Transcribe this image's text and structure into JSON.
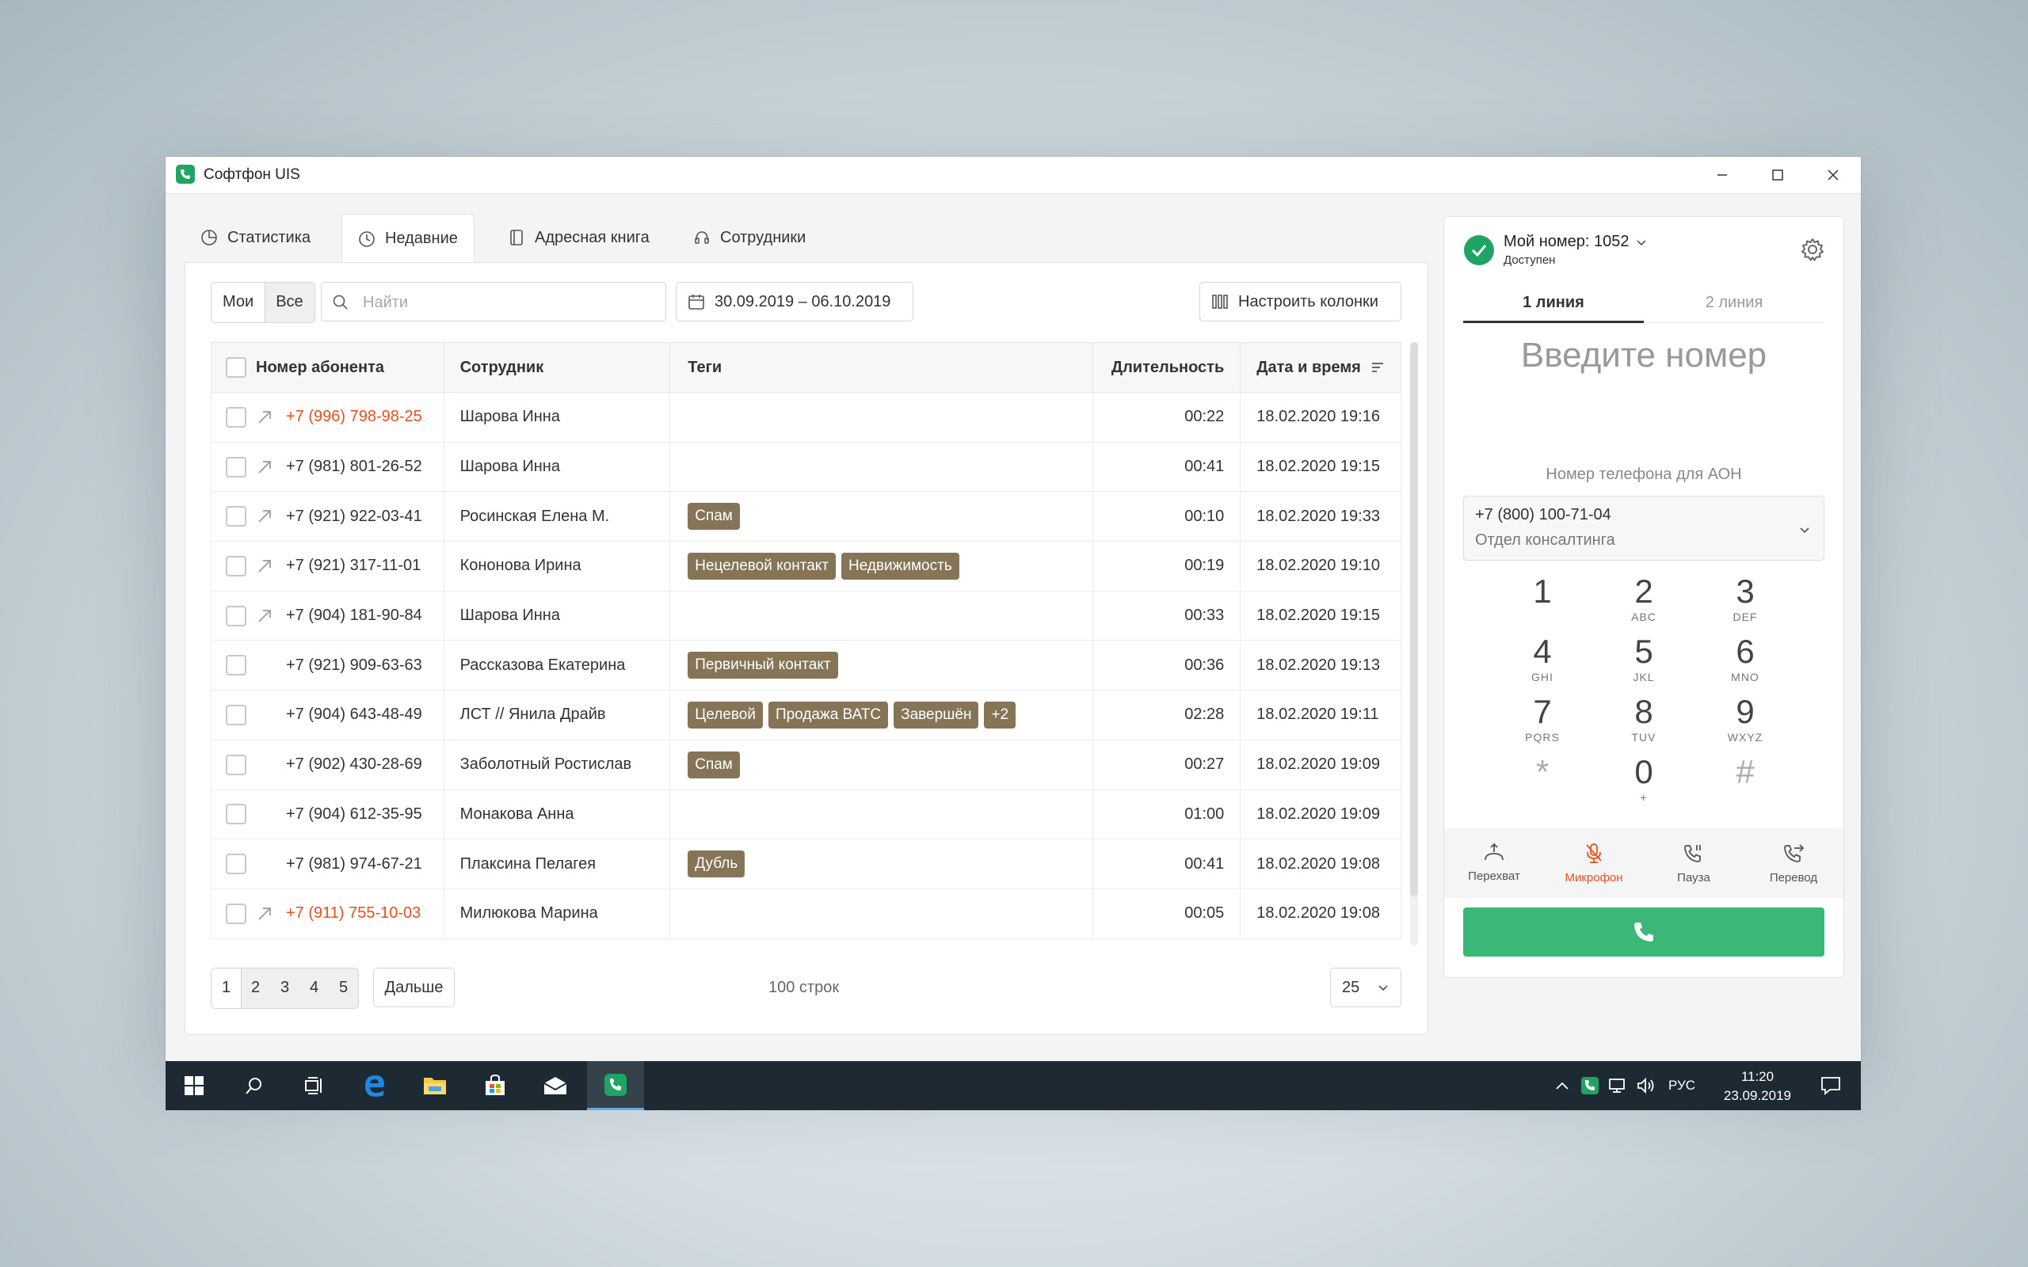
{
  "window": {
    "title": "Софтфон UIS"
  },
  "tabs": [
    {
      "label": "Статистика",
      "icon": "chart-icon"
    },
    {
      "label": "Недавние",
      "icon": "clock-icon"
    },
    {
      "label": "Адресная книга",
      "icon": "address-book-icon"
    },
    {
      "label": "Сотрудники",
      "icon": "employees-icon"
    }
  ],
  "filters": {
    "mine_label": "Мои",
    "all_label": "Все",
    "search_placeholder": "Найти",
    "search_value": "",
    "date_range": "30.09.2019 – 06.10.2019",
    "columns_button": "Настроить колонки"
  },
  "table": {
    "headers": [
      "Номер абонента",
      "Сотрудник",
      "Теги",
      "Длительность",
      "Дата и время"
    ],
    "rows": [
      {
        "number": "+7 (996) 798-98-25",
        "missed": true,
        "outgoing": true,
        "employee": "Шарова Инна",
        "tags": [],
        "duration": "00:22",
        "datetime": "18.02.2020 19:16"
      },
      {
        "number": "+7 (981) 801-26-52",
        "missed": false,
        "outgoing": true,
        "employee": "Шарова Инна",
        "tags": [],
        "duration": "00:41",
        "datetime": "18.02.2020 19:15"
      },
      {
        "number": "+7 (921) 922-03-41",
        "missed": false,
        "outgoing": true,
        "employee": "Росинская Елена М.",
        "tags": [
          "Спам"
        ],
        "duration": "00:10",
        "datetime": "18.02.2020 19:33"
      },
      {
        "number": "+7 (921) 317-11-01",
        "missed": false,
        "outgoing": true,
        "employee": "Кононова Ирина",
        "tags": [
          "Нецелевой контакт",
          "Недвижимость"
        ],
        "duration": "00:19",
        "datetime": "18.02.2020 19:10"
      },
      {
        "number": "+7 (904) 181-90-84",
        "missed": false,
        "outgoing": true,
        "employee": "Шарова Инна",
        "tags": [],
        "duration": "00:33",
        "datetime": "18.02.2020 19:15"
      },
      {
        "number": "+7 (921) 909-63-63",
        "missed": false,
        "outgoing": false,
        "employee": "Рассказова Екатерина",
        "tags": [
          "Первичный контакт"
        ],
        "duration": "00:36",
        "datetime": "18.02.2020 19:13"
      },
      {
        "number": "+7 (904) 643-48-49",
        "missed": false,
        "outgoing": false,
        "employee": "ЛСТ // Янила Драйв",
        "tags": [
          "Целевой",
          "Продажа ВАТС",
          "Завершён",
          "+2"
        ],
        "duration": "02:28",
        "datetime": "18.02.2020 19:11"
      },
      {
        "number": "+7 (902) 430-28-69",
        "missed": false,
        "outgoing": false,
        "employee": "Заболотный Ростислав",
        "tags": [
          "Спам"
        ],
        "duration": "00:27",
        "datetime": "18.02.2020 19:09"
      },
      {
        "number": "+7 (904) 612-35-95",
        "missed": false,
        "outgoing": false,
        "employee": "Монакова Анна",
        "tags": [],
        "duration": "01:00",
        "datetime": "18.02.2020 19:09"
      },
      {
        "number": "+7 (981) 974-67-21",
        "missed": false,
        "outgoing": false,
        "employee": "Плаксина Пелагея",
        "tags": [
          "Дубль"
        ],
        "duration": "00:41",
        "datetime": "18.02.2020 19:08"
      },
      {
        "number": "+7 (911) 755-10-03",
        "missed": true,
        "outgoing": true,
        "employee": "Милюкова Марина",
        "tags": [],
        "duration": "00:05",
        "datetime": "18.02.2020 19:08"
      }
    ]
  },
  "pagination": {
    "pages": [
      "1",
      "2",
      "3",
      "4",
      "5"
    ],
    "current": "1",
    "next_label": "Дальше",
    "rows_total": "100 строк",
    "per_page": "25"
  },
  "phone": {
    "my_number": "Мой номер: 1052",
    "status": "Доступен",
    "lines": [
      "1 линия",
      "2 линия"
    ],
    "number_placeholder": "Введите номер",
    "aon_label": "Номер телефона для АОН",
    "aon_number": "+7 (800) 100-71-04",
    "aon_department": "Отдел консалтинга",
    "keys": [
      {
        "digit": "1",
        "letters": ""
      },
      {
        "digit": "2",
        "letters": "ABC"
      },
      {
        "digit": "3",
        "letters": "DEF"
      },
      {
        "digit": "4",
        "letters": "GHI"
      },
      {
        "digit": "5",
        "letters": "JKL"
      },
      {
        "digit": "6",
        "letters": "MNO"
      },
      {
        "digit": "7",
        "letters": "PQRS"
      },
      {
        "digit": "8",
        "letters": "TUV"
      },
      {
        "digit": "9",
        "letters": "WXYZ"
      },
      {
        "digit": "*",
        "letters": ""
      },
      {
        "digit": "0",
        "letters": "+"
      },
      {
        "digit": "#",
        "letters": ""
      }
    ],
    "actions": [
      {
        "label": "Перехват",
        "icon": "intercept-icon"
      },
      {
        "label": "Микрофон",
        "icon": "microphone-muted-icon",
        "active": true
      },
      {
        "label": "Пауза",
        "icon": "hold-icon"
      },
      {
        "label": "Перевод",
        "icon": "transfer-icon"
      }
    ]
  },
  "taskbar": {
    "language": "РУС",
    "time": "11:20",
    "date": "23.09.2019"
  },
  "colors": {
    "accent_green": "#3bb877",
    "missed_red": "#e5501d",
    "tag_brown": "#857456"
  }
}
